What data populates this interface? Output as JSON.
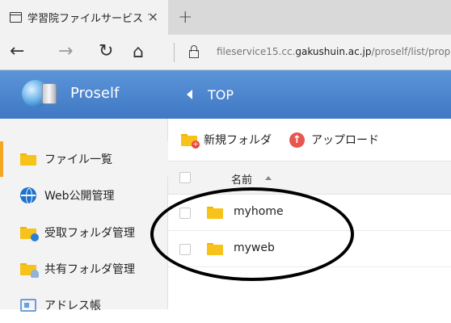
{
  "browser": {
    "tab_title": "学習院ファイルサービス ファ",
    "tab_close": "×",
    "new_tab": "+",
    "url_prefix": "fileservice15.cc.",
    "url_domain": "gakushuin.ac.jp",
    "url_path": "/proself/list/prop"
  },
  "app": {
    "logo_text": "Proself",
    "breadcrumb": "TOP"
  },
  "sidebar": {
    "items": [
      {
        "label": "ファイル一覧",
        "icon": "folder-icon"
      },
      {
        "label": "Web公開管理",
        "icon": "globe-icon"
      },
      {
        "label": "受取フォルダ管理",
        "icon": "receive-folder-icon"
      },
      {
        "label": "共有フォルダ管理",
        "icon": "shared-folder-icon"
      },
      {
        "label": "アドレス帳",
        "icon": "address-book-icon"
      }
    ]
  },
  "toolbar": {
    "new_folder": "新規フォルダ",
    "upload": "アップロード"
  },
  "list": {
    "header_name": "名前",
    "rows": [
      {
        "name": "myhome"
      },
      {
        "name": "myweb"
      }
    ]
  },
  "colors": {
    "header_blue": "#4a86cf",
    "accent_orange": "#f5a623",
    "folder_yellow": "#f7c21a"
  }
}
